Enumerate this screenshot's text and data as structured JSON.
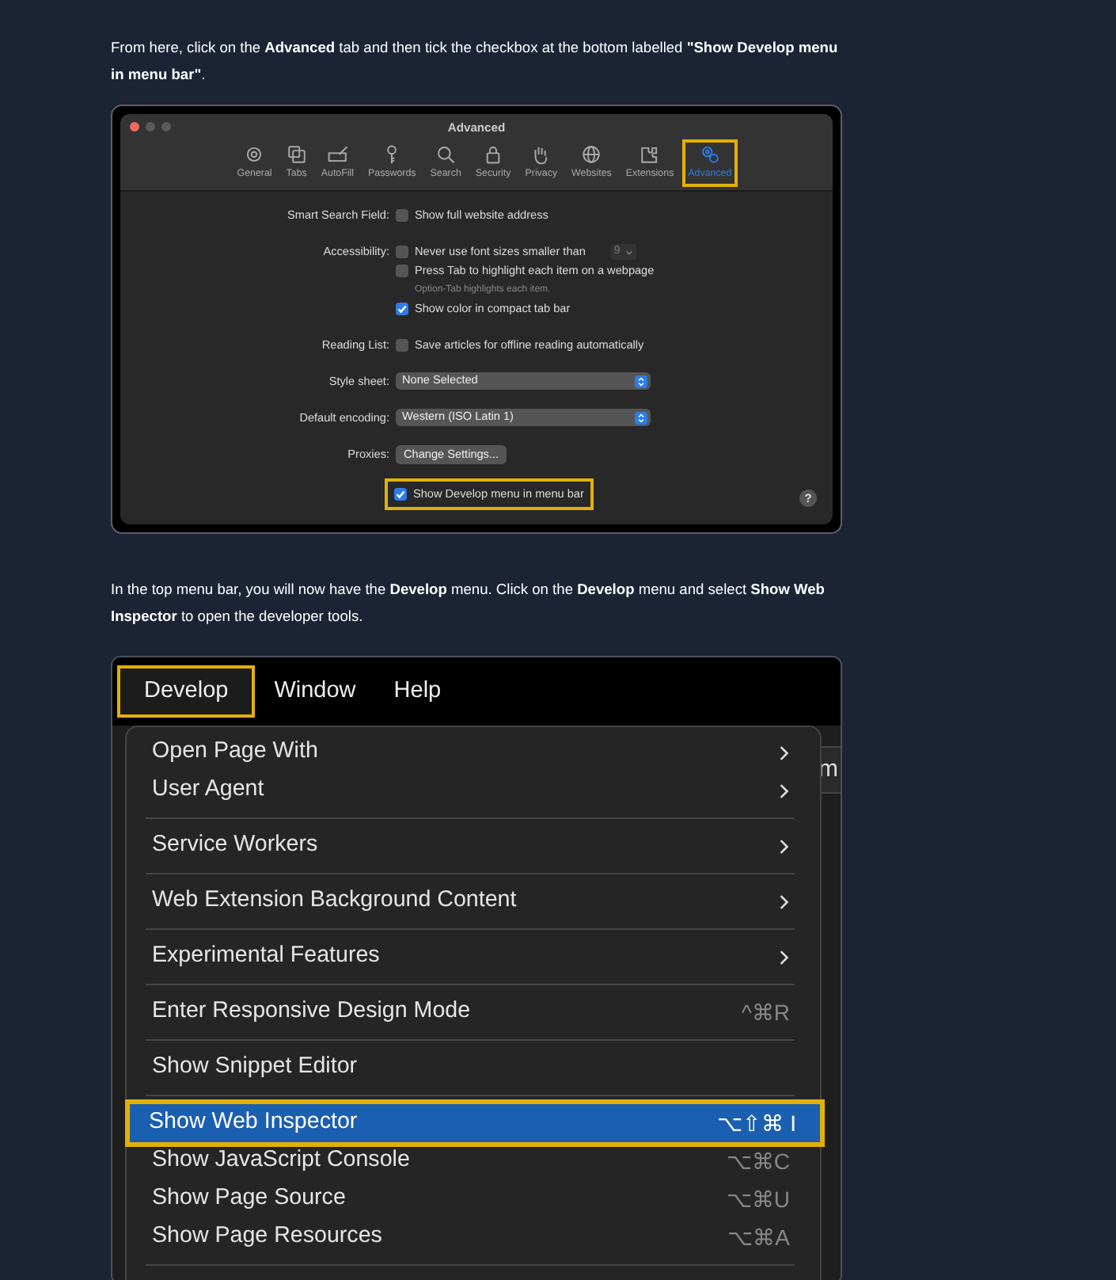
{
  "intro_text": "From here, click on the **Advanced** tab and then tick the checkbox at the bottom labelled **\"Show Develop menu in menu bar\"**.",
  "preferences_window": {
    "title": "Advanced",
    "tabs": [
      {
        "label": "General",
        "selected": false,
        "highlighted": false
      },
      {
        "label": "Tabs",
        "selected": false,
        "highlighted": false
      },
      {
        "label": "AutoFill",
        "selected": false,
        "highlighted": false
      },
      {
        "label": "Passwords",
        "selected": false,
        "highlighted": false
      },
      {
        "label": "Search",
        "selected": false,
        "highlighted": false
      },
      {
        "label": "Security",
        "selected": false,
        "highlighted": false
      },
      {
        "label": "Privacy",
        "selected": false,
        "highlighted": false
      },
      {
        "label": "Websites",
        "selected": false,
        "highlighted": false
      },
      {
        "label": "Extensions",
        "selected": false,
        "highlighted": false
      },
      {
        "label": "Advanced",
        "selected": true,
        "highlighted": true
      }
    ],
    "rows": [
      {
        "label": "Smart Search Field:",
        "controls": [
          {
            "kind": "checkbox",
            "text": "Show full website address",
            "checked": false,
            "highlighted": false
          }
        ]
      },
      {
        "label": "Accessibility:",
        "controls": [
          {
            "kind": "checkbox",
            "text": "Never use font sizes smaller than",
            "checked": false,
            "highlighted": false,
            "stepper": "9"
          },
          {
            "kind": "checkbox",
            "text": "Press Tab to highlight each item on a webpage",
            "checked": false,
            "highlighted": false
          },
          {
            "kind": "note",
            "text": "Option-Tab highlights each item."
          },
          {
            "kind": "checkbox",
            "text": "Show color in compact tab bar",
            "checked": true,
            "highlighted": false
          }
        ]
      },
      {
        "label": "Reading List:",
        "controls": [
          {
            "kind": "checkbox",
            "text": "Save articles for offline reading automatically",
            "checked": false,
            "highlighted": false
          }
        ]
      },
      {
        "label": "Style sheet:",
        "controls": [
          {
            "kind": "select",
            "text": "None Selected"
          }
        ]
      },
      {
        "label": "Default encoding:",
        "controls": [
          {
            "kind": "select",
            "text": "Western (ISO Latin 1)"
          }
        ]
      },
      {
        "label": "Proxies:",
        "controls": [
          {
            "kind": "button",
            "text": "Change Settings..."
          }
        ]
      },
      {
        "controls": [
          {
            "kind": "checkbox",
            "text": "Show Develop menu in menu bar",
            "checked": true,
            "highlighted": true
          }
        ]
      }
    ],
    "help_button": "?"
  },
  "menu_text": "In the top menu bar, you will now have the **Develop** menu. Click on the **Develop** menu and select **Show Web Inspector** to open the developer tools.",
  "menu_screenshot": {
    "menu_bar": [
      {
        "label": "Develop",
        "highlighted": true
      },
      {
        "label": "Window",
        "highlighted": false
      },
      {
        "label": "Help",
        "highlighted": false
      }
    ],
    "background_text": "m",
    "menu_items": [
      {
        "kind": "item",
        "label": "Open Page With",
        "submenu": true,
        "selected": false
      },
      {
        "kind": "item",
        "label": "User Agent",
        "submenu": true,
        "selected": false
      },
      {
        "kind": "separator"
      },
      {
        "kind": "item",
        "label": "Service Workers",
        "submenu": true,
        "selected": false
      },
      {
        "kind": "separator"
      },
      {
        "kind": "item",
        "label": "Web Extension Background Content",
        "submenu": true,
        "selected": false
      },
      {
        "kind": "separator"
      },
      {
        "kind": "item",
        "label": "Experimental Features",
        "submenu": true,
        "selected": false
      },
      {
        "kind": "separator"
      },
      {
        "kind": "item",
        "label": "Enter Responsive Design Mode",
        "shortcut": "^⌘R",
        "submenu": false,
        "selected": false
      },
      {
        "kind": "separator"
      },
      {
        "kind": "item",
        "label": "Show Snippet Editor",
        "submenu": false,
        "selected": false
      },
      {
        "kind": "separator"
      },
      {
        "kind": "item",
        "label": "Show Web Inspector",
        "shortcut": "⌥⇧⌘ I",
        "submenu": false,
        "selected": true
      },
      {
        "kind": "item",
        "label": "Show JavaScript Console",
        "shortcut": "⌥⌘C",
        "submenu": false,
        "selected": false
      },
      {
        "kind": "item",
        "label": "Show Page Source",
        "shortcut": "⌥⌘U",
        "submenu": false,
        "selected": false
      },
      {
        "kind": "item",
        "label": "Show Page Resources",
        "shortcut": "⌥⌘A",
        "submenu": false,
        "selected": false
      },
      {
        "kind": "separator"
      }
    ]
  }
}
